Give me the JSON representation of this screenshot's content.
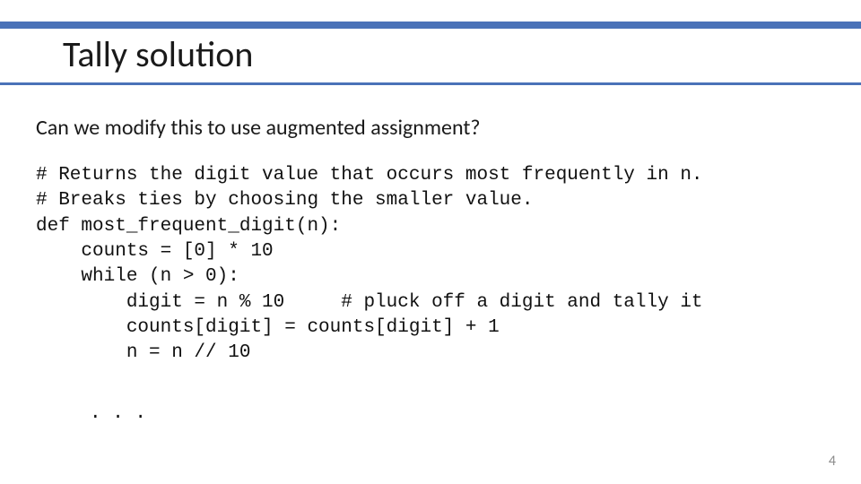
{
  "title": "Tally solution",
  "question": "Can we modify this to use augmented assignment?",
  "code": "# Returns the digit value that occurs most frequently in n.\n# Breaks ties by choosing the smaller value.\ndef most_frequent_digit(n):\n    counts = [0] * 10\n    while (n > 0):\n        digit = n % 10     # pluck off a digit and tally it\n        counts[digit] = counts[digit] + 1\n        n = n // 10",
  "ellipsis": ". . .",
  "page_number": "4"
}
